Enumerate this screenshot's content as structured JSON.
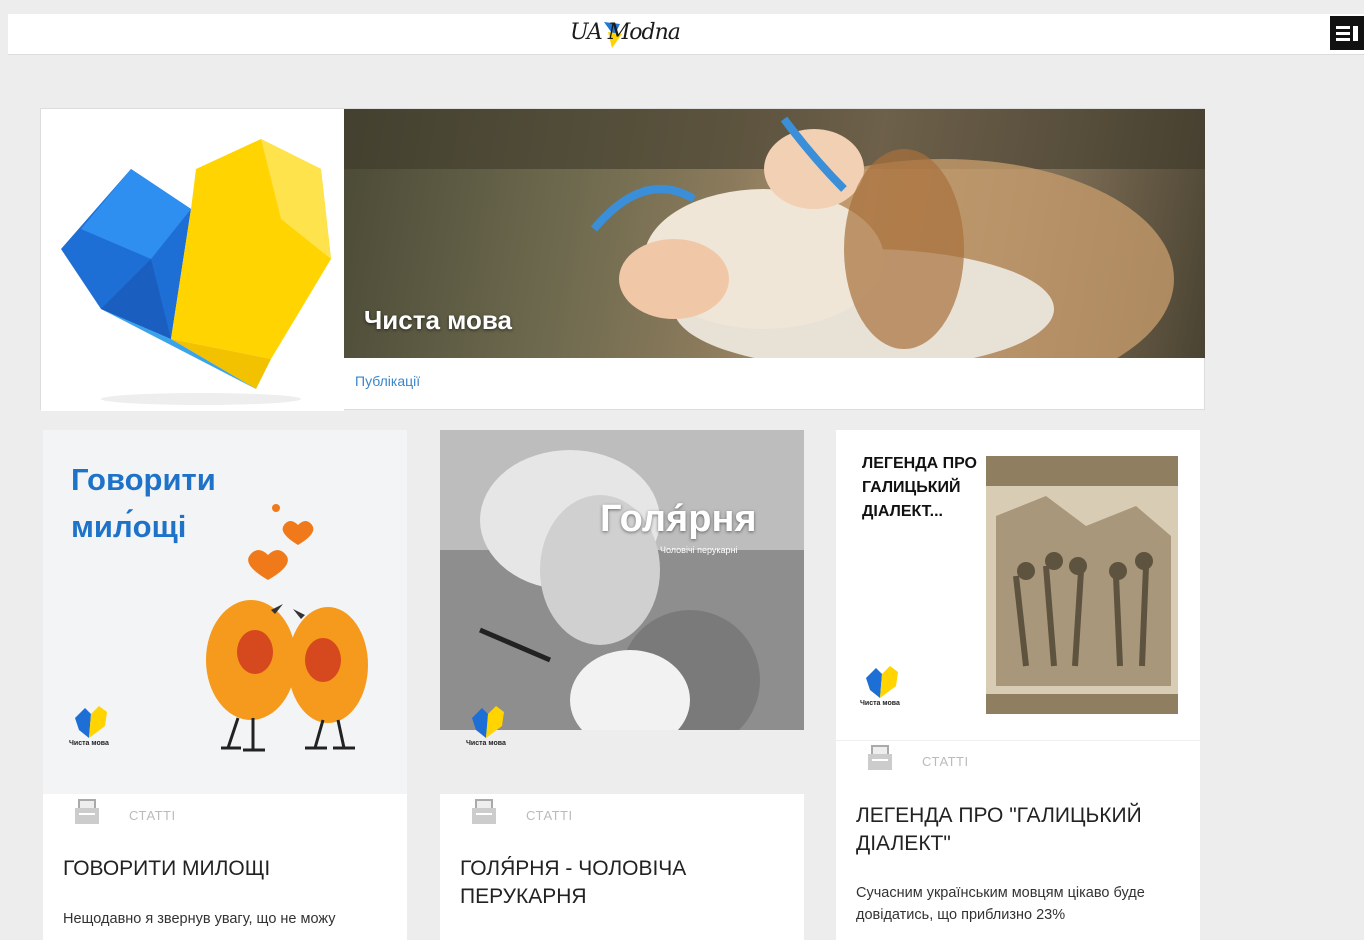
{
  "header": {
    "logo_text": "UA Modna",
    "menu_icon": "hamburger-icon"
  },
  "hero": {
    "title": "Чиста мова",
    "link": "Публікації",
    "colors": {
      "blue": "#1f78d8",
      "yellow": "#ffd200"
    }
  },
  "cards": [
    {
      "image_heading_line1": "Говорити",
      "image_heading_line2": "мил́ощі",
      "mini_logo_text": "Чиста мова",
      "category": "СТАТТІ",
      "title": "ГОВОРИТИ МИЛОЩІ",
      "excerpt": "Нещодавно я звернув увагу, що не можу"
    },
    {
      "image_heading": "Голя́рня",
      "image_subheading": "Чоловічі перукарні",
      "mini_logo_text": "Чиста мова",
      "category": "СТАТТІ",
      "title": "ГОЛЯ́РНЯ - ЧОЛОВІЧА ПЕРУКАРНЯ",
      "excerpt": ""
    },
    {
      "image_heading": "ЛЕГЕНДА ПРО ГАЛИЦЬКИЙ ДІАЛЕКТ...",
      "mini_logo_text": "Чиста мова",
      "category": "СТАТТІ",
      "title": "ЛЕГЕНДА ПРО \"ГАЛИЦЬКИЙ ДІАЛЕКТ\"",
      "excerpt": "Сучасним українським мовцям цікаво буде довідатись, що приблизно 23%"
    }
  ]
}
